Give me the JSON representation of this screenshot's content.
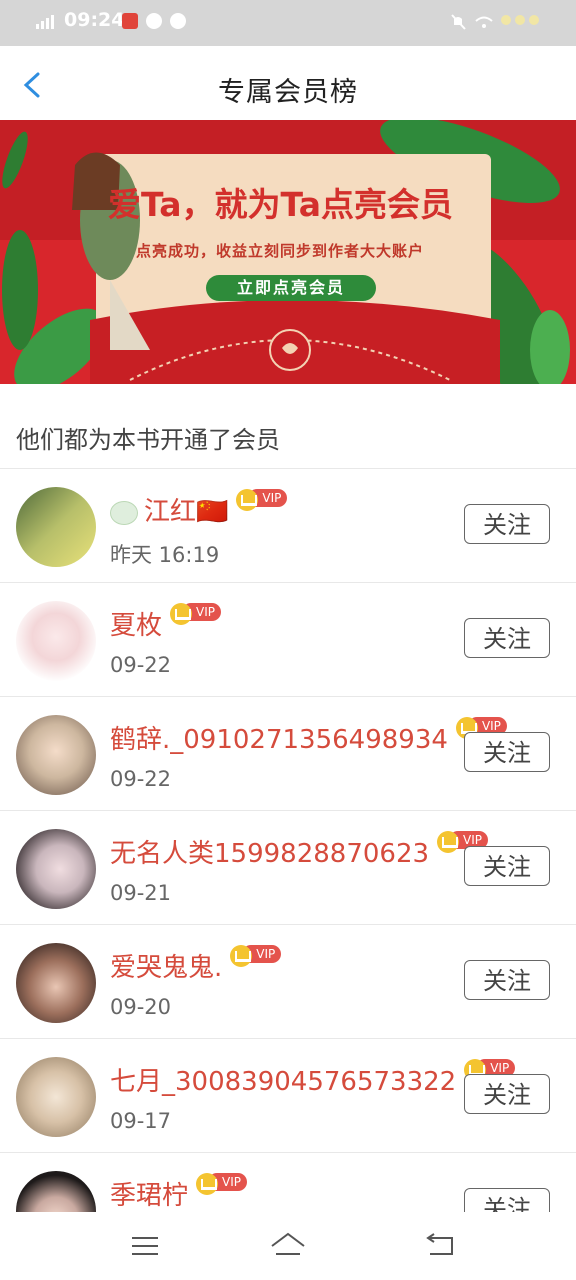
{
  "status_bar": {
    "time": "09:24"
  },
  "nav": {
    "title": "专属会员榜"
  },
  "banner": {
    "title": "爱Ta，就为Ta点亮会员",
    "subtitle": "点亮成功，收益立刻同步到作者大大账户",
    "button_label": "立即点亮会员"
  },
  "section": {
    "title": "他们都为本书开通了会员"
  },
  "vip_label": "VIP",
  "members": [
    {
      "name": "江红🇨🇳",
      "date": "昨天 16:19",
      "follow_label": "关注"
    },
    {
      "name": "夏枚",
      "date": "09-22",
      "follow_label": "关注"
    },
    {
      "name": "鹤辞._0910271356498934",
      "date": "09-22",
      "follow_label": "关注"
    },
    {
      "name": "无名人类1599828870623",
      "date": "09-21",
      "follow_label": "关注"
    },
    {
      "name": "爱哭鬼鬼.",
      "date": "09-20",
      "follow_label": "关注"
    },
    {
      "name": "七月_30083904576573322",
      "date": "09-17",
      "follow_label": "关注"
    },
    {
      "name": "季珺柠",
      "date": "",
      "follow_label": "关注"
    }
  ],
  "colors": {
    "accent_red": "#d54b3c",
    "banner_red": "#d8262c",
    "button_green": "#2e8b3a"
  }
}
